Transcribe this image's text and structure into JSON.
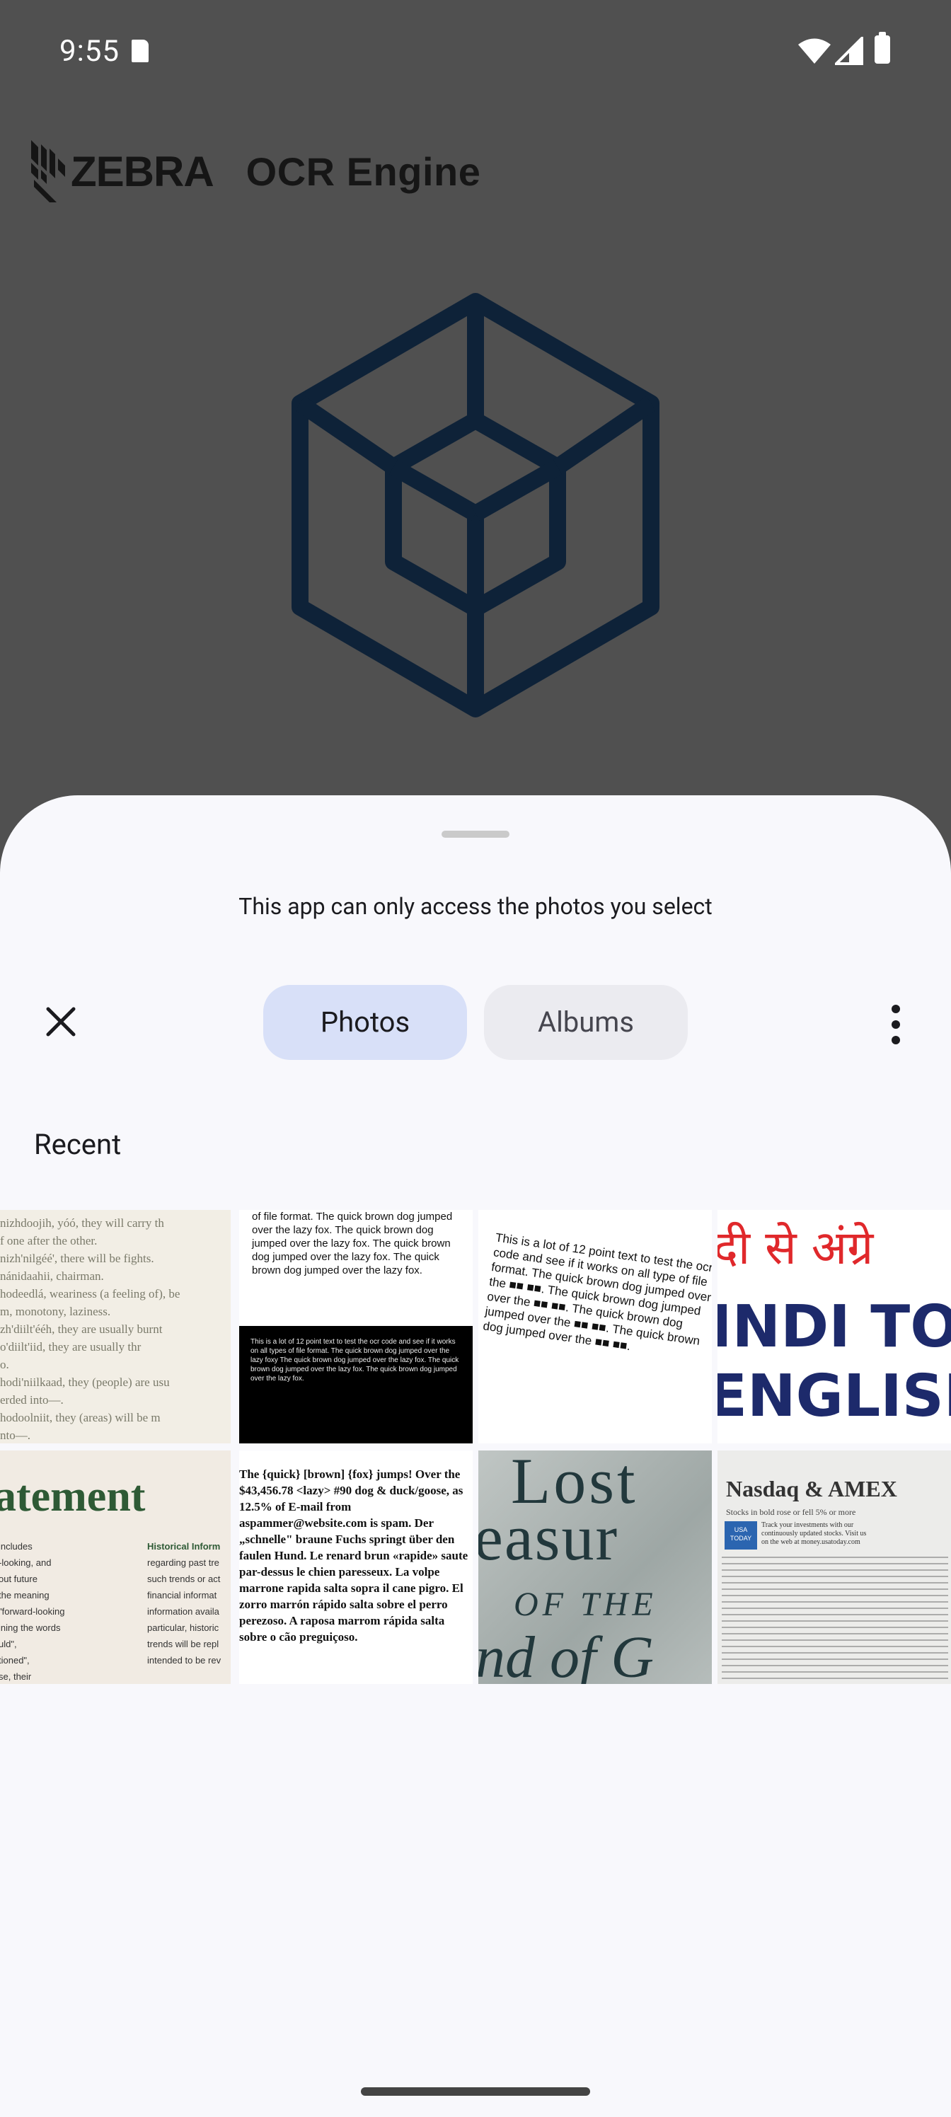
{
  "status": {
    "time": "9:55"
  },
  "app": {
    "brand": "ZEBRA",
    "title": "OCR Engine"
  },
  "sheet": {
    "notice": "This app can only access the photos you select",
    "tabs": {
      "photos": "Photos",
      "albums": "Albums"
    },
    "section": "Recent"
  },
  "thumbs": {
    "t1_lines": [
      "nizhdoojih, yóó, they will carry th",
      "f one after the other.",
      "nizh'nilgéé', there will be fights.",
      "nánidaahii, chairman.",
      "hodeedlá, weariness (a feeling of), be",
      "m, monotony, laziness.",
      "zh'diilt'ééh, they are usually burnt",
      "o'diilt'iid, they are usually thr",
      "o.",
      "hodi'niilkaad, they (people) are usu",
      "erded into—.",
      "hodoolniit, they (areas) will be m",
      "nto—."
    ],
    "t2_top": "of file format. The quick brown dog jumped over the lazy fox. The quick brown dog jumped over the lazy fox. The quick brown dog jumped over the lazy fox. The quick brown dog jumped over the lazy fox.",
    "t2_bottom": "This is a lot of 12 point text to test the ocr code and see if it works on all types of file format. The quick brown dog jumped over the lazy foxy The quick brown dog jumped over the lazy fox. The quick brown dog jumped over the lazy fox. The quick brown dog jumped over the lazy fox.",
    "t3_text": "This is a lot of 12 point text to test the ocr code and see if it works on all type of file format. The quick brown dog jumped over the ■■ ■■. The quick brown dog jumped over the ■■ ■■. The quick brown dog jumped over the ■■ ■■. The quick brown dog jumped over the ■■ ■■.",
    "t4_line1": "दी से अंग्रे",
    "t4_line2": "INDI TO",
    "t4_line3": "ENGLISH",
    "t5_heading": "atement",
    "t5_col1": [
      "includes",
      "-looking, and",
      "out future",
      "the meaning",
      "\"forward-looking",
      "ining the words",
      "uld\",",
      "tioned\",",
      "se, their"
    ],
    "t5_col2_head": "Historical Inform",
    "t5_col2": [
      "regarding past tre",
      "such trends or act",
      "financial informat",
      "information availa",
      "particular, historic",
      "trends will be repl",
      "intended to be rev"
    ],
    "t6_text": "The {quick} [brown] {fox} jumps! Over the $43,456.78 <lazy> #90 dog & duck/goose, as 12.5% of E-mail from aspammer@website.com is spam. Der „schnelle\" braune Fuchs springt über den faulen Hund. Le renard brun «rapide» saute par-dessus le chien paresseux. La volpe marrone rapida salta sopra il cane pigro. El zorro marrón rápido salta sobre el perro perezoso. A raposa marrom rápida salta sobre o cão preguiçoso.",
    "t7_lines": [
      "Lost",
      "easur",
      "OF THE",
      "nd of G"
    ],
    "t8_head": "Nasdaq & AMEX",
    "t8_sub": "Stocks in bold rose or fell 5% or more",
    "t8_promo": "Track your investments with our continuously updated stocks. Visit us on the web at money.usatoday.com",
    "t8_badge": "USA TODAY"
  },
  "colors": {
    "scrim": "#505050",
    "sheet": "#f8f8fc",
    "tab_selected": "#d8e0f8",
    "tab_unselected": "#ebebf0",
    "cube": "#0e2238"
  }
}
